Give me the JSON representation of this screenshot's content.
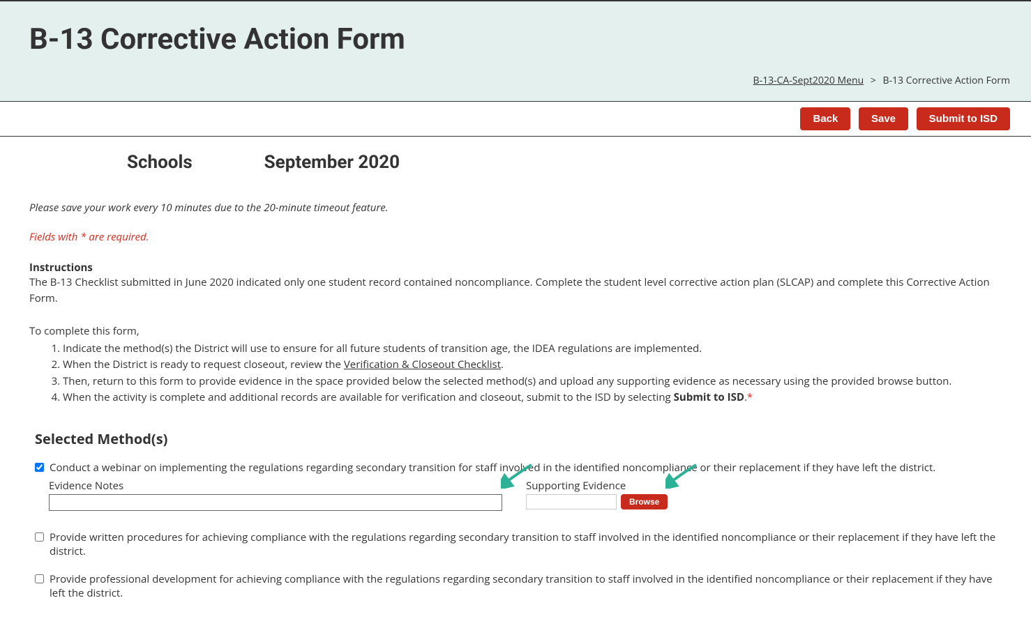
{
  "header": {
    "title": "B-13 Corrective Action Form",
    "breadcrumb": {
      "link": "B-13-CA-Sept2020 Menu",
      "separator": ">",
      "current": "B-13 Corrective Action Form"
    }
  },
  "actions": {
    "back": "Back",
    "save": "Save",
    "submit": "Submit to ISD"
  },
  "subheader": {
    "schools": "Schools",
    "period": "September 2020"
  },
  "notices": {
    "save": "Please save your work every 10 minutes due to the 20-minute timeout feature.",
    "required": "Fields with * are required."
  },
  "instructions": {
    "heading": "Instructions",
    "intro": "The B-13 Checklist submitted in June 2020 indicated only one student record contained noncompliance. Complete the student level corrective action plan (SLCAP) and complete this Corrective Action Form.",
    "lead": "To complete this form,",
    "step1": "Indicate the method(s) the District will use to ensure for all future students of transition age, the IDEA regulations are implemented.",
    "step2_pre": "When the District is ready to request closeout, review the ",
    "step2_link": "Verification & Closeout Checklist",
    "step2_post": ".",
    "step3": "Then, return to this form to provide evidence in the space provided below the selected method(s) and upload any supporting evidence as necessary using the provided browse button.",
    "step4_pre": "When the activity is complete and additional records are available for verification and closeout, submit to the ISD by selecting ",
    "step4_bold": "Submit to ISD",
    "step4_post": "."
  },
  "methods": {
    "heading": "Selected Method(s)",
    "item1": {
      "label": "Conduct a webinar on implementing the regulations regarding secondary transition for staff involved in the identified noncompliance or their replacement if they have left the district.",
      "checked": true,
      "evidence_notes_label": "Evidence Notes",
      "evidence_notes_value": "",
      "supporting_label": "Supporting Evidence",
      "supporting_value": "",
      "browse_label": "Browse"
    },
    "item2": {
      "label": "Provide written procedures for achieving compliance with the regulations regarding secondary transition to staff involved in the identified noncompliance or their replacement if they have left the district.",
      "checked": false
    },
    "item3": {
      "label": "Provide professional development for achieving compliance with the regulations regarding secondary transition to staff involved in the identified noncompliance or their replacement if they have left the district.",
      "checked": false
    }
  },
  "annotations": {
    "arrow_color": "#2db196"
  }
}
